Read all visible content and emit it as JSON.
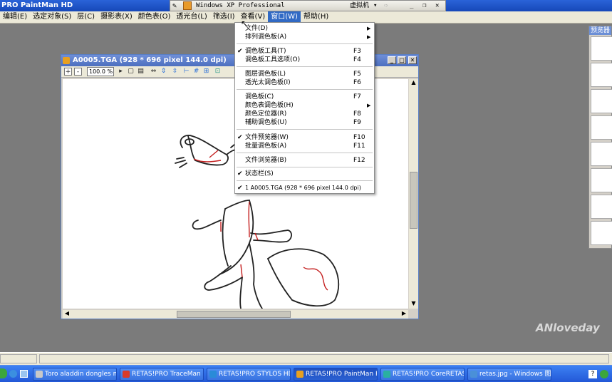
{
  "app": {
    "title": "PRO PaintMan HD"
  },
  "vm_bar": {
    "title": "Windows XP Professional",
    "vm_label": "虚拟机"
  },
  "menubar": {
    "items": [
      "编辑(E)",
      "选定对象(S)",
      "层(C)",
      "摄影表(X)",
      "颜色表(O)",
      "透光台(L)",
      "筛选(I)",
      "查看(V)",
      "窗口(W)",
      "帮助(H)"
    ]
  },
  "child_window": {
    "title": "A0005.TGA (928 * 696 pixel 144.0 dpi)",
    "zoom": "100.0 %"
  },
  "dropdown": {
    "items": [
      {
        "label": "文件(D)",
        "key": "",
        "check": false,
        "submenu": true
      },
      {
        "label": "排列调色板(A)",
        "key": "",
        "check": false,
        "submenu": true
      },
      {
        "label": "调色板工具(T)",
        "key": "F3",
        "check": true,
        "submenu": false
      },
      {
        "label": "调色板工具选项(O)",
        "key": "F4",
        "check": false,
        "submenu": false
      },
      {
        "label": "图层调色板(L)",
        "key": "F5",
        "check": false,
        "submenu": false
      },
      {
        "label": "透光太调色板(I)",
        "key": "F6",
        "check": false,
        "submenu": false
      },
      {
        "label": "调色板(C)",
        "key": "F7",
        "check": false,
        "submenu": false
      },
      {
        "label": "颜色表调色板(H)",
        "key": "",
        "check": false,
        "submenu": true
      },
      {
        "label": "颜色定位器(R)",
        "key": "F8",
        "check": false,
        "submenu": false
      },
      {
        "label": "辅助调色板(U)",
        "key": "F9",
        "check": false,
        "submenu": false
      },
      {
        "label": "文件预览器(W)",
        "key": "F10",
        "check": true,
        "submenu": false
      },
      {
        "label": "批量调色板(A)",
        "key": "F11",
        "check": false,
        "submenu": false
      },
      {
        "label": "文件浏览器(B)",
        "key": "F12",
        "check": false,
        "submenu": false
      },
      {
        "label": "状态栏(S)",
        "key": "",
        "check": true,
        "submenu": false
      },
      {
        "label": "1 A0005.TGA (928 * 696 pixel 144.0 dpi)",
        "key": "",
        "check": true,
        "submenu": false
      }
    ]
  },
  "preview": {
    "title": "预览器"
  },
  "watermark": "ANloveday",
  "taskbar": {
    "tasks": [
      {
        "label": "Toro aladdin dongles mo...",
        "color": "#c8c8c8",
        "active": false
      },
      {
        "label": "RETAS!PRO TraceMan HD",
        "color": "#d83a2a",
        "active": false
      },
      {
        "label": "RETAS!PRO STYLOS HD",
        "color": "#2a8bd8",
        "active": false
      },
      {
        "label": "RETAS!PRO PaintMan HD",
        "color": "#e8a020",
        "active": true
      },
      {
        "label": "RETAS!PRO CoreRETAS HD",
        "color": "#2ab0a0",
        "active": false
      },
      {
        "label": "retas.jpg - Windows 图...",
        "color": "#4a90d8",
        "active": false
      }
    ]
  }
}
